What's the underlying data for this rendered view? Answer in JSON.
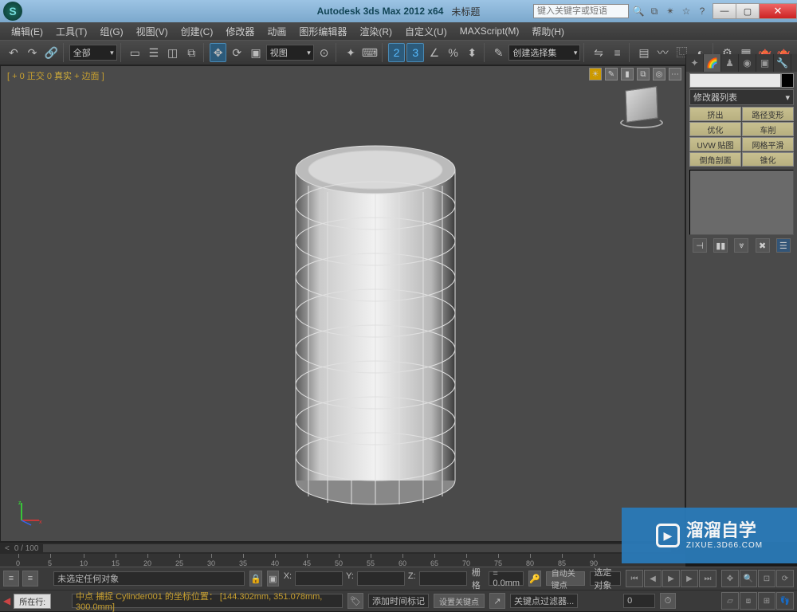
{
  "title": {
    "app": "Autodesk 3ds Max  2012 x64",
    "doc": "未标题"
  },
  "search": {
    "placeholder": "键入关键字或短语"
  },
  "menus": [
    "编辑(E)",
    "工具(T)",
    "组(G)",
    "视图(V)",
    "创建(C)",
    "修改器",
    "动画",
    "图形编辑器",
    "渲染(R)",
    "自定义(U)",
    "MAXScript(M)",
    "帮助(H)"
  ],
  "toolbar": {
    "all_label": "全部",
    "view_label": "视图",
    "selset_label": "创建选择集"
  },
  "viewport": {
    "bracket": "[ + 0 正交 0",
    "mode_prefix": "真实",
    "mode_suffix": "+ 边面 ]"
  },
  "cmdpanel": {
    "modlist": "修改器列表",
    "buttons": [
      [
        "挤出",
        "路径变形"
      ],
      [
        "优化",
        "车削"
      ],
      [
        "UVW 贴图",
        "网格平滑"
      ],
      [
        "倒角剖面",
        "锥化"
      ]
    ]
  },
  "timeline": {
    "counter": "0 / 100",
    "ticks": [
      0,
      5,
      10,
      15,
      20,
      25,
      30,
      35,
      40,
      45,
      50,
      55,
      60,
      65,
      70,
      75,
      80,
      85,
      90
    ]
  },
  "status": {
    "nosel": "未选定任何对象",
    "x": "X:",
    "y": "Y:",
    "z": "Z:",
    "grid_label": "栅格",
    "grid_val": "= 0.0mm",
    "autokey": "自动关键点",
    "selset2": "选定对象",
    "tab": "所在行:",
    "snap": "中点 捕捉 Cylinder001 的坐标位置：  [144.302mm, 351.078mm, 300.0mm]",
    "addmark": "添加时间标记",
    "setkey": "设置关键点",
    "keyfilter": "关键点过滤器..."
  },
  "watermark": {
    "cn": "溜溜自学",
    "url": "ZIXUE.3D66.COM"
  }
}
